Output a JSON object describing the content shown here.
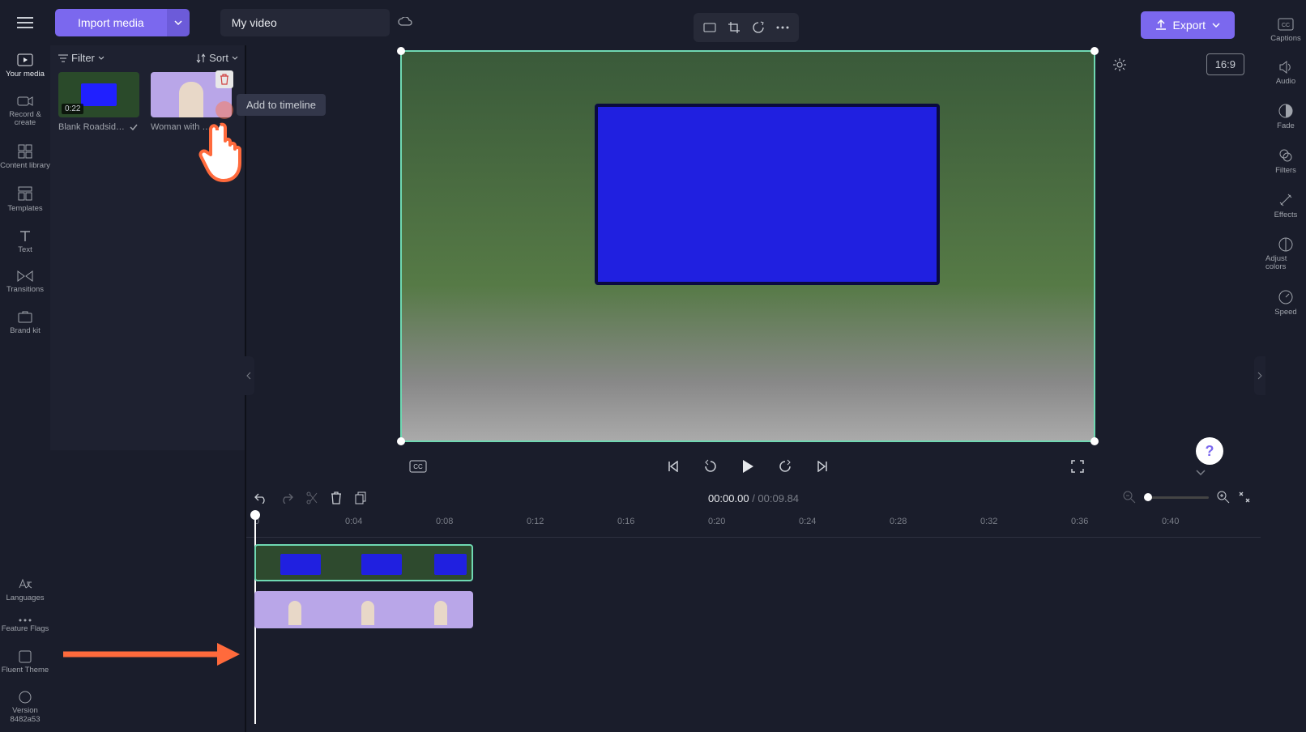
{
  "header": {
    "import_label": "Import media",
    "project_name": "My video",
    "export_label": "Export"
  },
  "sidebar_left": {
    "items": [
      {
        "label": "Your media"
      },
      {
        "label": "Record & create"
      },
      {
        "label": "Content library"
      },
      {
        "label": "Templates"
      },
      {
        "label": "Text"
      },
      {
        "label": "Transitions"
      },
      {
        "label": "Brand kit"
      }
    ],
    "bottom_items": [
      {
        "label": "Languages"
      },
      {
        "label": "Feature Flags"
      },
      {
        "label": "Fluent Theme"
      },
      {
        "label": "Version 8482a53"
      }
    ]
  },
  "media_panel": {
    "filter_label": "Filter",
    "sort_label": "Sort",
    "thumbs": [
      {
        "label": "Blank Roadsid…",
        "duration": "0:22"
      },
      {
        "label": "Woman with …"
      }
    ],
    "tooltip": "Add to timeline"
  },
  "preview": {
    "aspect_label": "16:9"
  },
  "playback": {
    "current": "00:00.00",
    "separator": " / ",
    "total": "00:09.84"
  },
  "timeline": {
    "ticks": [
      "0",
      "0:04",
      "0:08",
      "0:12",
      "0:16",
      "0:20",
      "0:24",
      "0:28",
      "0:32",
      "0:36",
      "0:40"
    ]
  },
  "sidebar_right": {
    "items": [
      {
        "label": "Captions"
      },
      {
        "label": "Audio"
      },
      {
        "label": "Fade"
      },
      {
        "label": "Filters"
      },
      {
        "label": "Effects"
      },
      {
        "label": "Adjust colors"
      },
      {
        "label": "Speed"
      }
    ]
  },
  "help_label": "?"
}
